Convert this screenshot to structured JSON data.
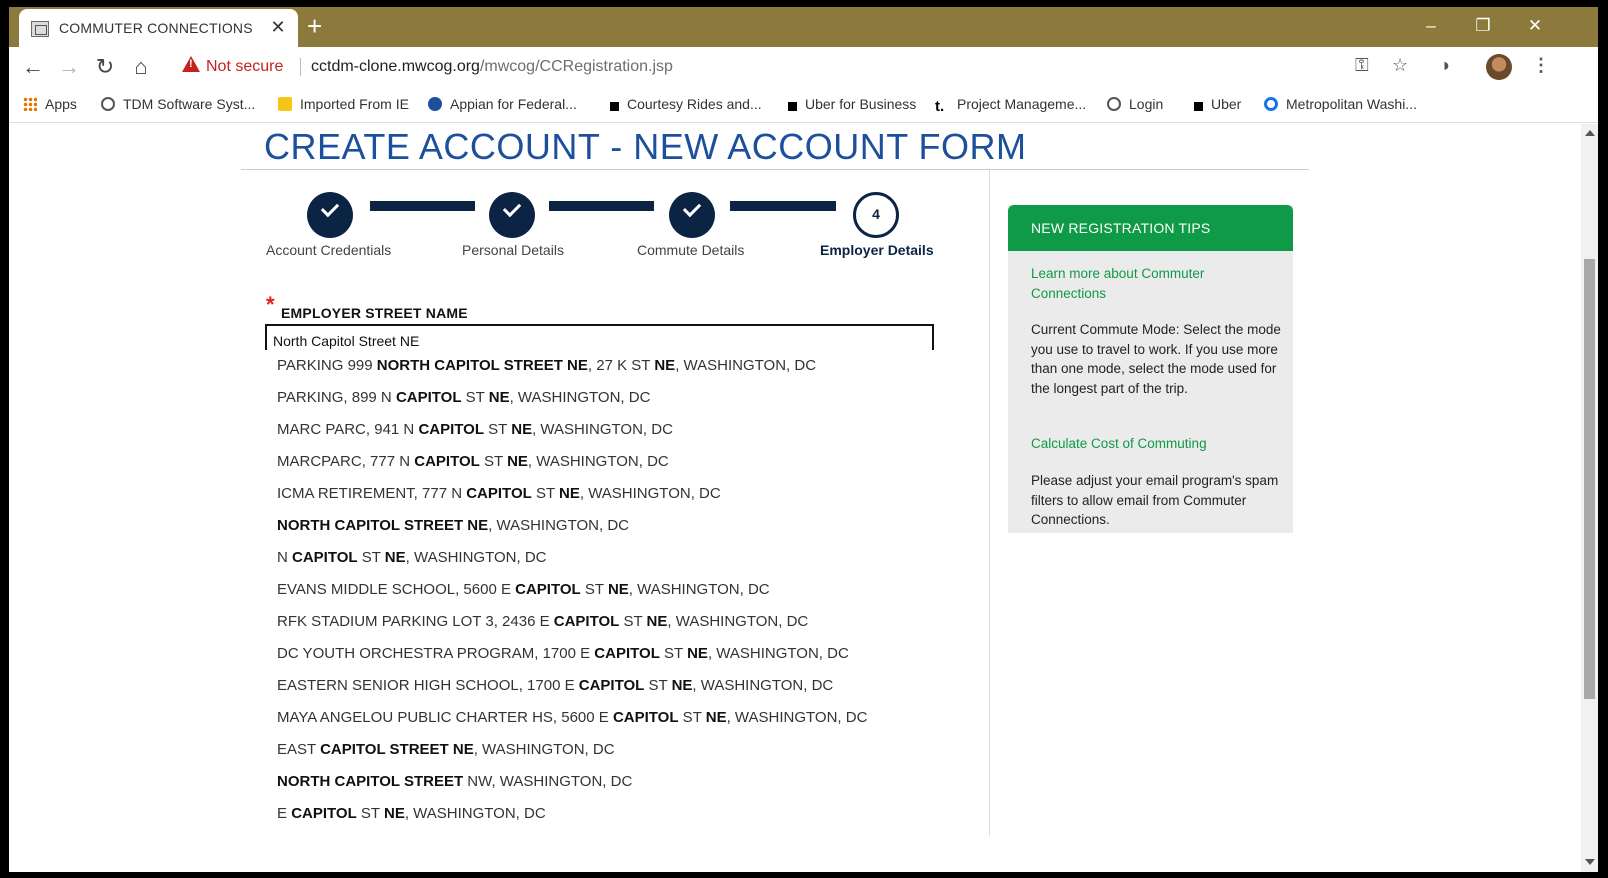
{
  "browser": {
    "tab_title": "COMMUTER CONNECTIONS",
    "tab_close": "✕",
    "new_tab": "+",
    "security_label": "Not secure",
    "url_host": "cctdm-clone.mwcog.org",
    "url_path": "/mwcog/CCRegistration.jsp",
    "window_controls": {
      "minimize": "–",
      "restore": "❐",
      "close": "✕"
    }
  },
  "bookmarks": [
    {
      "label": "Apps",
      "icon": "apps-grid-icon",
      "color": "#e37400"
    },
    {
      "label": "TDM Software Syst...",
      "icon": "globe-icon",
      "color": "#555555"
    },
    {
      "label": "Imported From IE",
      "icon": "folder-icon",
      "color": "#f5c518"
    },
    {
      "label": "Appian for Federal...",
      "icon": "appian-icon",
      "color": "#1c4f9c"
    },
    {
      "label": "Courtesy Rides and...",
      "icon": "square-icon",
      "color": "#000000"
    },
    {
      "label": "Uber for Business",
      "icon": "square-icon",
      "color": "#000000"
    },
    {
      "label": "Project Manageme...",
      "icon": "t-icon",
      "color": "#000000"
    },
    {
      "label": "Login",
      "icon": "globe-icon",
      "color": "#555555"
    },
    {
      "label": "Uber",
      "icon": "square-icon",
      "color": "#000000"
    },
    {
      "label": "Metropolitan Washi...",
      "icon": "ring-icon",
      "color": "#1a73e8"
    }
  ],
  "page": {
    "title": "CREATE ACCOUNT - NEW ACCOUNT FORM"
  },
  "stepper": {
    "steps": [
      {
        "label": "Account Credentials",
        "state": "complete"
      },
      {
        "label": "Personal Details",
        "state": "complete"
      },
      {
        "label": "Commute Details",
        "state": "complete"
      },
      {
        "label": "Employer Details",
        "state": "current",
        "number": "4"
      }
    ]
  },
  "form": {
    "required_marker": "*",
    "employer_street_label": "EMPLOYER STREET NAME",
    "employer_street_value": "North Capitol Street NE"
  },
  "suggestions": [
    [
      [
        "PARKING 999 ",
        false
      ],
      [
        "NORTH CAPITOL STREET NE",
        true
      ],
      [
        ", 27 K ST ",
        false
      ],
      [
        "NE",
        true
      ],
      [
        ", WASHINGTON, DC",
        false
      ]
    ],
    [
      [
        "PARKING, 899 N ",
        false
      ],
      [
        "CAPITOL",
        true
      ],
      [
        " ST ",
        false
      ],
      [
        "NE",
        true
      ],
      [
        ", WASHINGTON, DC",
        false
      ]
    ],
    [
      [
        "MARC PARC, 941 N ",
        false
      ],
      [
        "CAPITOL",
        true
      ],
      [
        " ST ",
        false
      ],
      [
        "NE",
        true
      ],
      [
        ", WASHINGTON, DC",
        false
      ]
    ],
    [
      [
        "MARCPARC, 777 N ",
        false
      ],
      [
        "CAPITOL",
        true
      ],
      [
        " ST ",
        false
      ],
      [
        "NE",
        true
      ],
      [
        ", WASHINGTON, DC",
        false
      ]
    ],
    [
      [
        "ICMA RETIREMENT, 777 N ",
        false
      ],
      [
        "CAPITOL",
        true
      ],
      [
        " ST ",
        false
      ],
      [
        "NE",
        true
      ],
      [
        ", WASHINGTON, DC",
        false
      ]
    ],
    [
      [
        "NORTH CAPITOL STREET NE",
        true
      ],
      [
        ", WASHINGTON, DC",
        false
      ]
    ],
    [
      [
        "N ",
        false
      ],
      [
        "CAPITOL",
        true
      ],
      [
        " ST ",
        false
      ],
      [
        "NE",
        true
      ],
      [
        ", WASHINGTON, DC",
        false
      ]
    ],
    [
      [
        "EVANS MIDDLE SCHOOL, 5600 E ",
        false
      ],
      [
        "CAPITOL",
        true
      ],
      [
        " ST ",
        false
      ],
      [
        "NE",
        true
      ],
      [
        ", WASHINGTON, DC",
        false
      ]
    ],
    [
      [
        "RFK STADIUM PARKING LOT 3, 2436 E ",
        false
      ],
      [
        "CAPITOL",
        true
      ],
      [
        " ST ",
        false
      ],
      [
        "NE",
        true
      ],
      [
        ", WASHINGTON, DC",
        false
      ]
    ],
    [
      [
        "DC YOUTH ORCHESTRA PROGRAM, 1700 E ",
        false
      ],
      [
        "CAPITOL",
        true
      ],
      [
        " ST ",
        false
      ],
      [
        "NE",
        true
      ],
      [
        ", WASHINGTON, DC",
        false
      ]
    ],
    [
      [
        "EASTERN SENIOR HIGH SCHOOL, 1700 E ",
        false
      ],
      [
        "CAPITOL",
        true
      ],
      [
        " ST ",
        false
      ],
      [
        "NE",
        true
      ],
      [
        ", WASHINGTON, DC",
        false
      ]
    ],
    [
      [
        "MAYA ANGELOU PUBLIC CHARTER HS, 5600 E ",
        false
      ],
      [
        "CAPITOL",
        true
      ],
      [
        " ST ",
        false
      ],
      [
        "NE",
        true
      ],
      [
        ", WASHINGTON, DC",
        false
      ]
    ],
    [
      [
        "EAST ",
        false
      ],
      [
        "CAPITOL STREET NE",
        true
      ],
      [
        ", WASHINGTON, DC",
        false
      ]
    ],
    [
      [
        "NORTH CAPITOL STREET",
        true
      ],
      [
        " NW, WASHINGTON, DC",
        false
      ]
    ],
    [
      [
        "E ",
        false
      ],
      [
        "CAPITOL",
        true
      ],
      [
        " ST ",
        false
      ],
      [
        "NE",
        true
      ],
      [
        ", WASHINGTON, DC",
        false
      ]
    ]
  ],
  "tips": {
    "header": "NEW REGISTRATION TIPS",
    "learn_more": "Learn more about Commuter Connections",
    "commute_mode": "Current Commute Mode: Select the mode you use to travel to work. If you use more than one mode, select the mode used for the longest part of the trip.",
    "calculate_cost": "Calculate Cost of Commuting",
    "email_note": "Please adjust your email program's spam filters to allow email from Commuter Connections."
  },
  "colors": {
    "title_blue": "#1c4f9c",
    "stepper_navy": "#0c2444",
    "tips_green": "#0f9a47",
    "tab_strip": "#8c7a3d",
    "required_red": "#e02020"
  }
}
